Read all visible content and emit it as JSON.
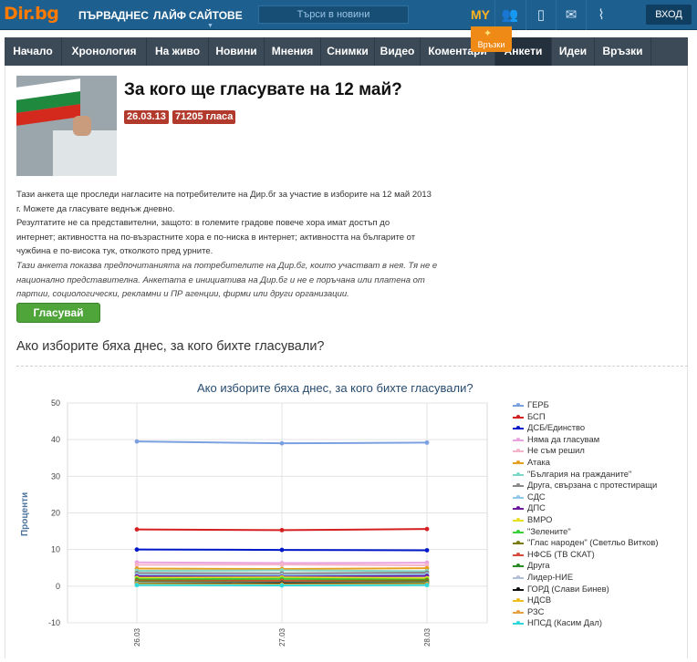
{
  "topbar": {
    "logo": "Dir.bg",
    "nav": [
      "ПЪРВА",
      "ДНЕС",
      "ЛАЙФ",
      "САЙТОВЕ"
    ],
    "search_placeholder": "Търси в новини",
    "my_label": "MY",
    "login_label": "ВХОД"
  },
  "subnav": {
    "items": [
      "Начало",
      "Хронология",
      "На живо",
      "Новини",
      "Мнения",
      "Снимки",
      "Видео",
      "Коментари",
      "Анкети",
      "Идеи",
      "Връзки"
    ],
    "active_index": 8,
    "floating_tag": "Връзки"
  },
  "poll": {
    "title": "За кого ще гласувате на 12 май?",
    "date": "26.03.13",
    "votes": "71205 гласа",
    "description_lines": [
      "Тази анкета ще проследи нагласите на потребителите на Дир.бг за участие в изборите на 12 май 2013",
      "г. Можете да гласувате веднъж дневно.",
      "Резултатите не са представителни, защото: в големите градове повече хора имат достъп до",
      "интернет; активността на по-възрастните хора е по-ниска в интернет; активността на българите от",
      "чужбина е по-висока тук, отколкото пред урните."
    ],
    "disclaimer_lines": [
      "Тази анкета показва предпочитанията на потребителите на Дир.бг, които участват в нея. Тя не е",
      "национално представителна. Анкетата е инициатива на Дир.бг и не е поръчана или платена от",
      "партии, социологически, рекламни и ПР агенции, фирми или други организации."
    ],
    "vote_button": "Гласувай",
    "question": "Ако изборите бяха днес, за кого бихте гласували?"
  },
  "chart_data": {
    "type": "line",
    "title": "Ако изборите бяха днес, за кого бихте гласували?",
    "ylabel": "Проценти",
    "xlabel": "",
    "x": [
      "26.03",
      "27.03",
      "28.03"
    ],
    "ylim": [
      -10,
      50
    ],
    "yticks": [
      50,
      40,
      30,
      20,
      10,
      0,
      -10
    ],
    "grid": true,
    "legend_position": "right",
    "series": [
      {
        "name": "ГЕРБ",
        "color": "#7aa0e0",
        "values": [
          39.5,
          39.0,
          39.2
        ]
      },
      {
        "name": "БСП",
        "color": "#d42020",
        "values": [
          15.5,
          15.3,
          15.6
        ]
      },
      {
        "name": "ДСБ/Единство",
        "color": "#0018c8",
        "values": [
          10.0,
          9.9,
          9.8
        ]
      },
      {
        "name": "Няма да гласувам",
        "color": "#e9a3e0",
        "values": [
          6.5,
          6.3,
          6.4
        ]
      },
      {
        "name": "Не съм решил",
        "color": "#f5b4c8",
        "values": [
          5.8,
          5.9,
          5.7
        ]
      },
      {
        "name": "Атака",
        "color": "#e6a020",
        "values": [
          4.8,
          4.7,
          4.9
        ]
      },
      {
        "name": "\"България на гражданите\"",
        "color": "#7ed8c8",
        "values": [
          4.2,
          4.3,
          4.1
        ]
      },
      {
        "name": "Друга, свързана с протестиращи",
        "color": "#888888",
        "values": [
          3.6,
          3.5,
          3.7
        ]
      },
      {
        "name": "СДС",
        "color": "#8fc8ec",
        "values": [
          3.1,
          3.0,
          3.2
        ]
      },
      {
        "name": "ДПС",
        "color": "#6a1aa0",
        "values": [
          2.7,
          2.6,
          2.8
        ]
      },
      {
        "name": "ВМРО",
        "color": "#e8e020",
        "values": [
          2.3,
          2.4,
          2.2
        ]
      },
      {
        "name": "\"Зелените\"",
        "color": "#3ad03a",
        "values": [
          1.9,
          2.0,
          1.8
        ]
      },
      {
        "name": "\"Глас народен\" (Светльо Витков)",
        "color": "#7a7a10",
        "values": [
          1.6,
          1.5,
          1.6
        ]
      },
      {
        "name": "НФСБ (ТВ СКАТ)",
        "color": "#d84a3a",
        "values": [
          1.3,
          1.4,
          1.2
        ]
      },
      {
        "name": "Друга",
        "color": "#2a8a2a",
        "values": [
          1.1,
          1.0,
          1.1
        ]
      },
      {
        "name": "Лидер-НИЕ",
        "color": "#b0c0d8",
        "values": [
          0.9,
          0.9,
          0.8
        ]
      },
      {
        "name": "ГОРД (Слави Бинев)",
        "color": "#111111",
        "values": [
          0.7,
          0.8,
          0.7
        ]
      },
      {
        "name": "НДСВ",
        "color": "#f0c020",
        "values": [
          0.6,
          0.5,
          0.6
        ]
      },
      {
        "name": "РЗС",
        "color": "#e8a040",
        "values": [
          0.4,
          0.4,
          0.4
        ]
      },
      {
        "name": "НПСД (Касим Дал)",
        "color": "#30d8d8",
        "values": [
          0.3,
          0.2,
          0.3
        ]
      }
    ]
  }
}
